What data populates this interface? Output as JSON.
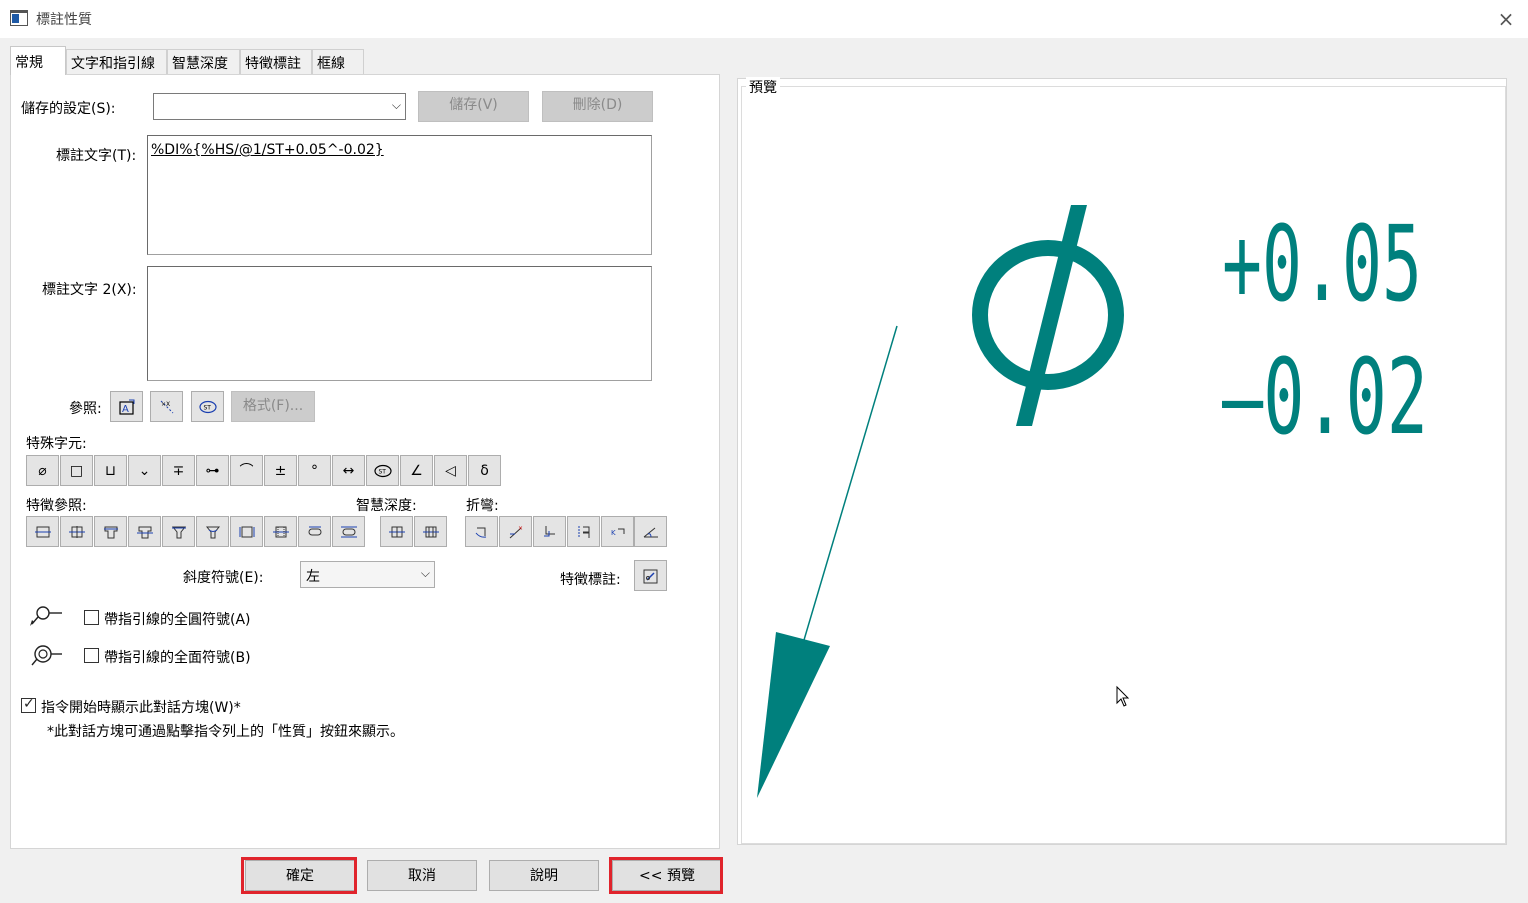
{
  "window": {
    "title": "標註性質",
    "close_icon": "×"
  },
  "tabs": [
    {
      "label": "常規",
      "active": true
    },
    {
      "label": "文字和指引線"
    },
    {
      "label": "智慧深度"
    },
    {
      "label": "特徵標註"
    },
    {
      "label": "框線"
    }
  ],
  "saved_settings": {
    "label": "儲存的設定(S):",
    "value": "",
    "save_label": "儲存(V)",
    "delete_label": "刪除(D)"
  },
  "callout_text": {
    "label": "標註文字(T):",
    "value": "%DI%{%HS/@1/ST+0.05^-0.02}"
  },
  "callout_text2": {
    "label": "標註文字 2(X):",
    "value": ""
  },
  "reference": {
    "label": "參照:",
    "format_label": "格式(F)..."
  },
  "special_chars": {
    "label": "特殊字元:",
    "symbols": [
      "⌀",
      "□",
      "⊔",
      "⌄",
      "∓",
      "⊶",
      "⌒",
      "±",
      "°",
      "↔",
      "ST",
      "∠",
      "◁",
      "δ"
    ]
  },
  "feature_ref": {
    "label": "特徵參照:"
  },
  "smart_depth": {
    "label": "智慧深度:"
  },
  "bend": {
    "label": "折彎:"
  },
  "slope": {
    "label": "斜度符號(E):",
    "value": "左"
  },
  "feature_callout": {
    "label": "特徵標註:"
  },
  "options": {
    "all_around": "帶指引線的全圓符號(A)",
    "all_over": "帶指引線的全面符號(B)",
    "show_on_start": "指令開始時顯示此對話方塊(W)*",
    "note": "*此對話方塊可通過點擊指令列上的「性質」按鈕來顯示。"
  },
  "preview": {
    "label": "預覽",
    "upper_tol": "+0.05",
    "lower_tol": "–0.02",
    "color": "#00807d"
  },
  "buttons": {
    "ok": "確定",
    "cancel": "取消",
    "help": "說明",
    "preview": "<< 預覽"
  },
  "highlight_color": "#e0242c"
}
